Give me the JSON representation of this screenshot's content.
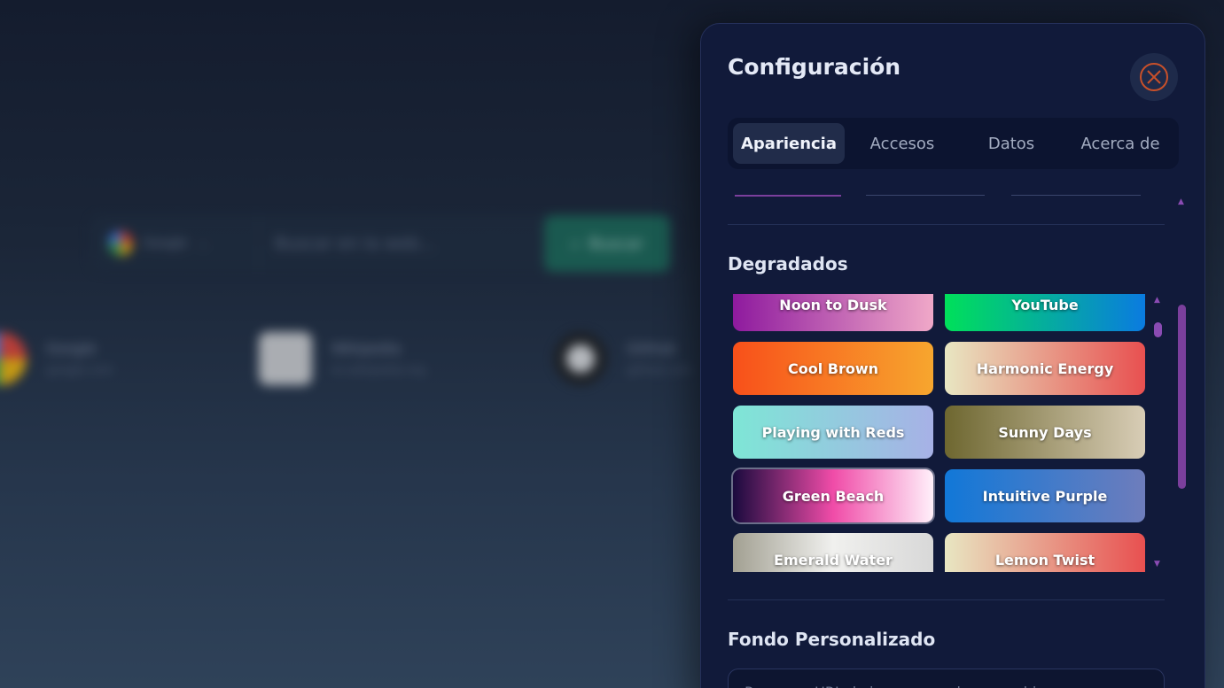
{
  "background": {
    "search": {
      "engine": "Google",
      "placeholder": "Buscar en la web...",
      "button_label": "Buscar"
    },
    "shortcuts": [
      {
        "name": "Google",
        "url": "google.com"
      },
      {
        "name": "Wikipedia",
        "url": "es.wikipedia.org"
      },
      {
        "name": "GitHub",
        "url": "github.com"
      }
    ]
  },
  "settings": {
    "title": "Configuración",
    "tabs": [
      "Apariencia",
      "Accesos",
      "Datos",
      "Acerca de"
    ],
    "active_tab": "Apariencia",
    "gradients_title": "Degradados",
    "gradients": [
      {
        "label": "Noon to Dusk",
        "colors": [
          "#8e1a9e",
          "#f0a8c8"
        ]
      },
      {
        "label": "YouTube",
        "colors": [
          "#00e05a",
          "#0a7be0"
        ]
      },
      {
        "label": "Cool Brown",
        "colors": [
          "#f8501a",
          "#f7a62e"
        ]
      },
      {
        "label": "Harmonic Energy",
        "colors": [
          "#e8e6c2",
          "#e85050"
        ]
      },
      {
        "label": "Playing with Reds",
        "colors": [
          "#7ee6d6",
          "#a7b1e6"
        ]
      },
      {
        "label": "Sunny Days",
        "colors": [
          "#6e6730",
          "#d8cdb6"
        ]
      },
      {
        "label": "Green Beach",
        "colors": [
          "#1a0a3e",
          "#f04ca8",
          "#fff0fa"
        ],
        "selected": true
      },
      {
        "label": "Intuitive Purple",
        "colors": [
          "#1178d8",
          "#6e7dbc"
        ]
      },
      {
        "label": "Emerald Water",
        "colors": [
          "#a2a092",
          "#f0f0ee",
          "#d8d8d8"
        ]
      },
      {
        "label": "Lemon Twist",
        "colors": [
          "#e8e6c2",
          "#e85050"
        ]
      }
    ],
    "custom_bg_title": "Fondo Personalizado",
    "custom_bg_placeholder": "Pega una URL de imagen o sube un archivo"
  },
  "colors": {
    "panel_bg": "#111a3a",
    "accent": "#8a4bb3",
    "close_icon": "#c8502a"
  }
}
